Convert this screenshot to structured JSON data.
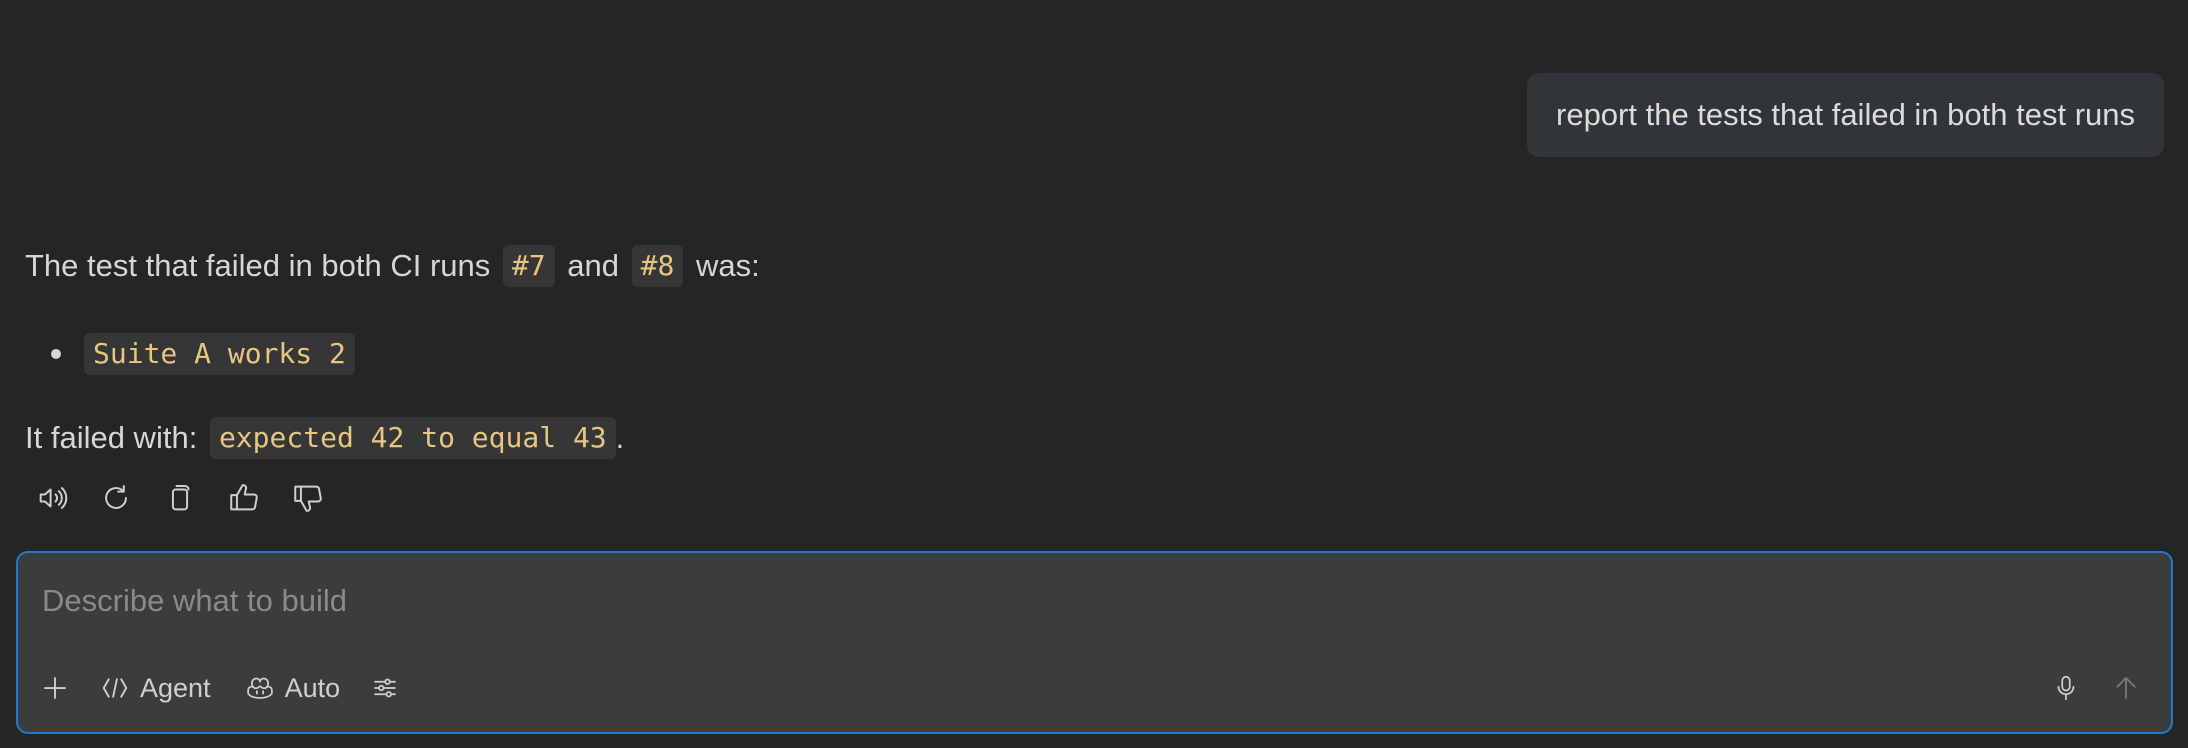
{
  "chat": {
    "user_message": "report the tests that failed in both test runs",
    "assistant": {
      "intro_before": "The test that failed in both CI runs",
      "run_a": "#7",
      "intro_and": "and",
      "run_b": "#8",
      "intro_after": "was:",
      "failed_tests": [
        "Suite A works 2"
      ],
      "failure_prefix": "It failed with:",
      "failure_message": "expected 42 to equal 43",
      "failure_suffix": "."
    },
    "actions": {
      "icons": [
        "speaker-icon",
        "refresh-icon",
        "copy-icon",
        "thumbs-up-icon",
        "thumbs-down-icon"
      ]
    }
  },
  "composer": {
    "placeholder": "Describe what to build",
    "agent_label": "Agent",
    "model_label": "Auto"
  },
  "colors": {
    "background": "#252525",
    "composer_bg": "#3c3c3c",
    "composer_border": "#1f7ac8",
    "code_text": "#e7c582",
    "user_bubble": "#313538"
  }
}
